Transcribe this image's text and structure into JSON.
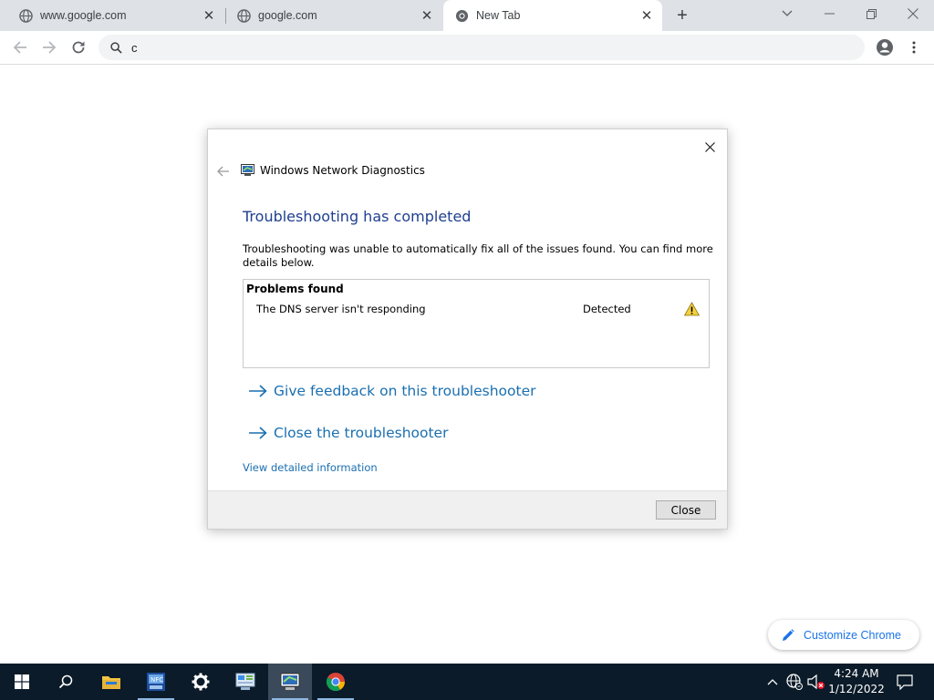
{
  "tabs": [
    {
      "title": "www.google.com",
      "active": false
    },
    {
      "title": "google.com",
      "active": false
    },
    {
      "title": "New Tab",
      "active": true
    }
  ],
  "toolbar": {
    "address_value": "c"
  },
  "dialog": {
    "app_title": "Windows Network Diagnostics",
    "heading": "Troubleshooting has completed",
    "description": "Troubleshooting was unable to automatically fix all of the issues found. You can find more details below.",
    "problems_header": "Problems found",
    "problem": {
      "name": "The DNS server isn't responding",
      "status": "Detected"
    },
    "links": {
      "feedback": "Give feedback on this troubleshooter",
      "close_troubleshooter": "Close the troubleshooter",
      "details": "View detailed information"
    },
    "close_button": "Close"
  },
  "customize_chrome": "Customize Chrome",
  "taskbar": {
    "time": "4:24 AM",
    "date": "1/12/2022"
  },
  "colors": {
    "accent_link": "#1a6fb0",
    "heading_blue": "#1f3f8f",
    "taskbar": "#0b1b29",
    "chrome_tabstrip": "#dee1e6"
  }
}
